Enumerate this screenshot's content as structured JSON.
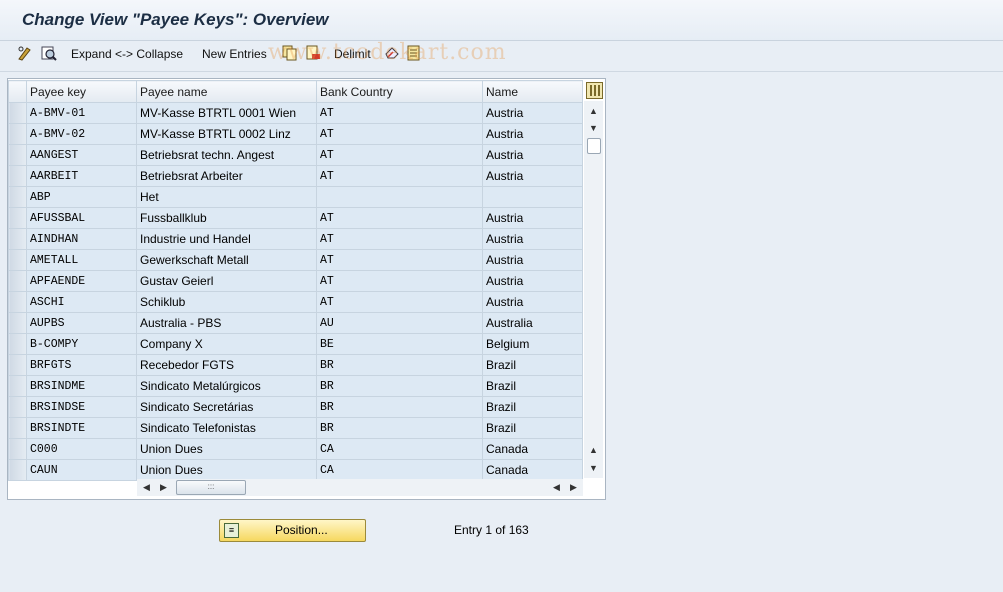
{
  "title": "Change View \"Payee Keys\": Overview",
  "watermark": "www.tcodekart.com",
  "toolbar": {
    "expand_collapse": "Expand <-> Collapse",
    "new_entries": "New Entries",
    "delimit": "Delimit",
    "icons": [
      "edit-glasses-icon",
      "other-view-icon",
      "copy-icon",
      "delete-icon",
      "undo-icon",
      "select-all-icon"
    ]
  },
  "table": {
    "columns": [
      "Payee key",
      "Payee name",
      "Bank Country",
      "Name"
    ],
    "rows": [
      [
        "A-BMV-01",
        "MV-Kasse  BTRTL 0001 Wien",
        "AT",
        "Austria"
      ],
      [
        "A-BMV-02",
        "MV-Kasse  BTRTL 0002 Linz",
        "AT",
        "Austria"
      ],
      [
        "AANGEST",
        "Betriebsrat techn. Angest",
        "AT",
        "Austria"
      ],
      [
        "AARBEIT",
        "Betriebsrat Arbeiter",
        "AT",
        "Austria"
      ],
      [
        "ABP",
        "Het",
        "",
        ""
      ],
      [
        "AFUSSBAL",
        "Fussballklub",
        "AT",
        "Austria"
      ],
      [
        "AINDHAN",
        "Industrie und Handel",
        "AT",
        "Austria"
      ],
      [
        "AMETALL",
        "Gewerkschaft Metall",
        "AT",
        "Austria"
      ],
      [
        "APFAENDE",
        "Gustav Geierl",
        "AT",
        "Austria"
      ],
      [
        "ASCHI",
        "Schiklub",
        "AT",
        "Austria"
      ],
      [
        "AUPBS",
        "Australia - PBS",
        "AU",
        "Australia"
      ],
      [
        "B-COMPY",
        "Company X",
        "BE",
        "Belgium"
      ],
      [
        "BRFGTS",
        "Recebedor FGTS",
        "BR",
        "Brazil"
      ],
      [
        "BRSINDME",
        "Sindicato Metalúrgicos",
        "BR",
        "Brazil"
      ],
      [
        "BRSINDSE",
        "Sindicato Secretárias",
        "BR",
        "Brazil"
      ],
      [
        "BRSINDTE",
        "Sindicato Telefonistas",
        "BR",
        "Brazil"
      ],
      [
        "C000",
        "Union Dues",
        "CA",
        "Canada"
      ],
      [
        "CAUN",
        "Union Dues",
        "CA",
        "Canada"
      ]
    ]
  },
  "position_button": "Position...",
  "entry_info": "Entry 1 of 163"
}
